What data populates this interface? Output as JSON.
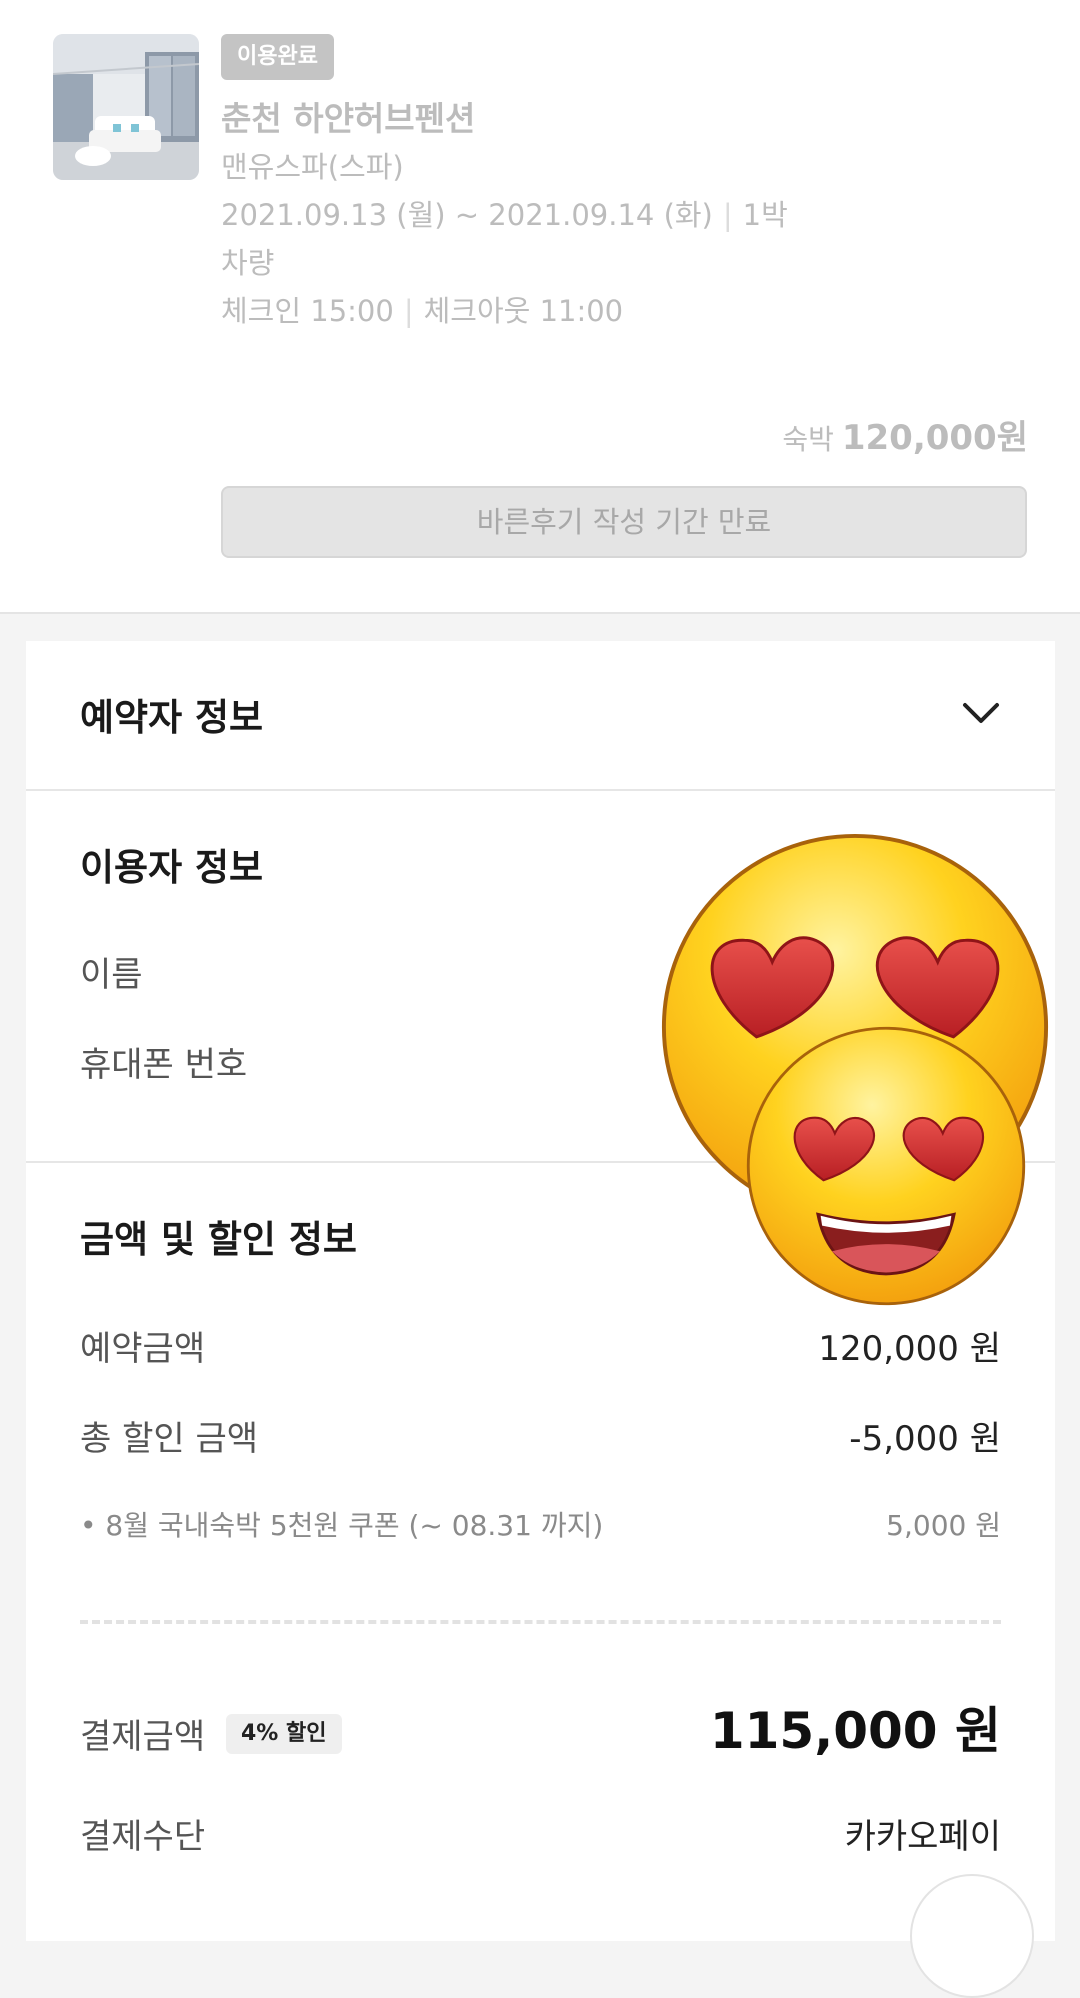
{
  "reservation": {
    "status_badge": "이용완료",
    "hotel_name": "춘천 하얀허브펜션",
    "room_name": "맨유스파(스파)",
    "dates": "2021.09.13 (월) ~ 2021.09.14 (화)",
    "nights": "1박",
    "visit_type": "차량",
    "checkin": "체크인 15:00",
    "checkout": "체크아웃 11:00",
    "price_label": "숙박",
    "price": "120,000원",
    "review_button": "바른후기 작성 기간 만료"
  },
  "booker_section": {
    "title": "예약자 정보",
    "icon": "chevron-down-icon"
  },
  "user_section": {
    "title": "이용자 정보",
    "name_label": "이름",
    "phone_label": "휴대폰 번호"
  },
  "payment_section": {
    "title": "금액 및 할인 정보",
    "reservation_amount_label": "예약금액",
    "reservation_amount": "120,000 원",
    "total_discount_label": "총 할인 금액",
    "total_discount": "-5,000 원",
    "coupon_label": "• 8월 국내숙박 5천원 쿠폰 (~ 08.31 까지)",
    "coupon_amount": "5,000 원",
    "payment_amount_label": "결제금액",
    "discount_badge": "4% 할인",
    "payment_amount": "115,000 원",
    "payment_method_label": "결제수단",
    "payment_method": "카카오페이"
  },
  "overlay": {
    "emoji": "heart-eyes-emoji-icon"
  }
}
